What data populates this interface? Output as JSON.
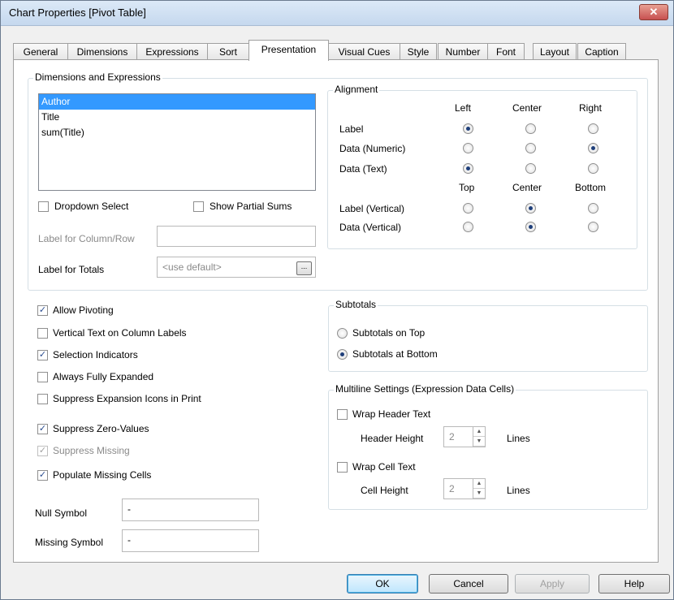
{
  "window": {
    "title": "Chart Properties [Pivot Table]",
    "close_glyph": "✕"
  },
  "tabs": [
    {
      "label": "General"
    },
    {
      "label": "Dimensions"
    },
    {
      "label": "Expressions"
    },
    {
      "label": "Sort"
    },
    {
      "label": "Presentation"
    },
    {
      "label": "Visual Cues"
    },
    {
      "label": "Style"
    },
    {
      "label": "Number"
    },
    {
      "label": "Font"
    },
    {
      "label": "Layout"
    },
    {
      "label": "Caption"
    }
  ],
  "dim_expr": {
    "group_label": "Dimensions and Expressions",
    "items": [
      "Author",
      "Title",
      "sum(Title)"
    ],
    "dropdown_select": "Dropdown Select",
    "show_partial_sums": "Show Partial Sums",
    "label_col_row": "Label for Column/Row",
    "label_col_row_value": "",
    "label_totals": "Label for Totals",
    "label_totals_placeholder": "<use default>",
    "ellipsis": "..."
  },
  "alignment": {
    "group_label": "Alignment",
    "col_left": "Left",
    "col_center": "Center",
    "col_right": "Right",
    "row_label": "Label",
    "row_numeric": "Data (Numeric)",
    "row_text": "Data (Text)",
    "col_top": "Top",
    "col_vcenter": "Center",
    "col_bottom": "Bottom",
    "row_label_v": "Label (Vertical)",
    "row_data_v": "Data (Vertical)"
  },
  "options": {
    "allow_pivoting": "Allow Pivoting",
    "vertical_text": "Vertical Text on Column Labels",
    "selection_indicators": "Selection Indicators",
    "always_expanded": "Always Fully Expanded",
    "suppress_icons": "Suppress Expansion Icons in Print",
    "suppress_zero": "Suppress Zero-Values",
    "suppress_missing": "Suppress Missing",
    "populate_missing": "Populate Missing Cells",
    "null_symbol_label": "Null Symbol",
    "null_symbol_value": "-",
    "missing_symbol_label": "Missing Symbol",
    "missing_symbol_value": "-"
  },
  "subtotals": {
    "group_label": "Subtotals",
    "on_top": "Subtotals on Top",
    "at_bottom": "Subtotals at Bottom"
  },
  "multiline": {
    "group_label": "Multiline Settings (Expression Data Cells)",
    "wrap_header": "Wrap Header Text",
    "header_height_label": "Header Height",
    "header_height_value": "2",
    "lines": "Lines",
    "wrap_cell": "Wrap Cell Text",
    "cell_height_label": "Cell Height",
    "cell_height_value": "2"
  },
  "buttons": {
    "ok": "OK",
    "cancel": "Cancel",
    "apply": "Apply",
    "help": "Help"
  },
  "checkmark": "✓",
  "spin_up": "▲",
  "spin_down": "▼"
}
